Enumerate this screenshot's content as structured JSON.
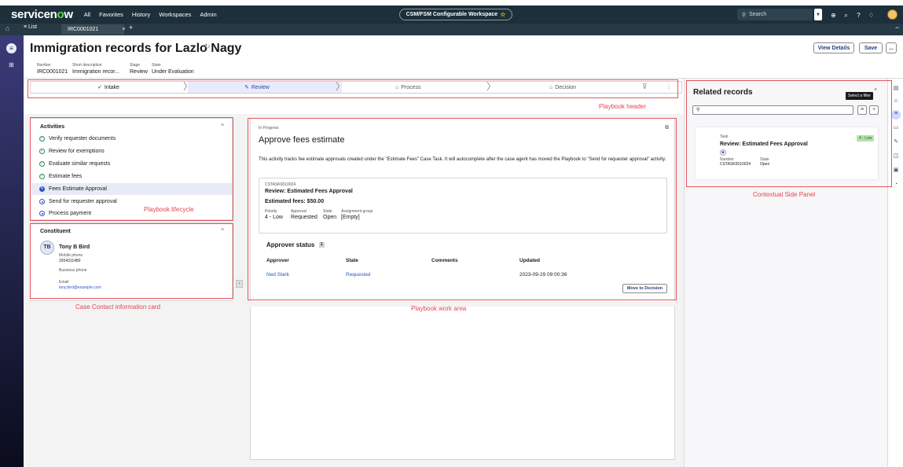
{
  "nav": {
    "logo_text": "servicenow",
    "links": [
      "All",
      "Favorites",
      "History",
      "Workspaces",
      "Admin"
    ],
    "workspace_title": "CSM/FSM Configurable Workspace",
    "search_placeholder": "Search"
  },
  "tabs": {
    "list_label": "List",
    "active_tab": "IRC0001021"
  },
  "record": {
    "title": "Immigration records for Lazlo Nagy",
    "fields": [
      {
        "label": "Number",
        "value": "IRC0001021"
      },
      {
        "label": "Short description",
        "value": "Immigration recor..."
      },
      {
        "label": "Stage",
        "value": "Review"
      },
      {
        "label": "State",
        "value": "Under Evaluation"
      }
    ],
    "buttons": {
      "view_details": "View Details",
      "save": "Save",
      "more": "..."
    }
  },
  "playbook": {
    "stages": [
      {
        "label": "Intake",
        "status": "done"
      },
      {
        "label": "Review",
        "status": "current"
      },
      {
        "label": "Process",
        "status": "locked"
      },
      {
        "label": "Decision",
        "status": "locked"
      }
    ]
  },
  "activities": {
    "title": "Activities",
    "items": [
      {
        "label": "Verify requester documents",
        "status": "done"
      },
      {
        "label": "Review for exemptions",
        "status": "done"
      },
      {
        "label": "Evaluate similar requests",
        "status": "done"
      },
      {
        "label": "Estimate fees",
        "status": "done"
      },
      {
        "label": "Fees Estimate Approval",
        "status": "current"
      },
      {
        "label": "Send for requester approval",
        "status": "pending"
      },
      {
        "label": "Process payment",
        "status": "pending"
      }
    ]
  },
  "constituent": {
    "title": "Constituent",
    "initials": "TB",
    "name": "Tony B Bird",
    "mobile_label": "Mobile phone",
    "mobile_value": "3204311480",
    "business_label": "Business phone",
    "email_label": "Email",
    "email_value": "tony.bird@example.com"
  },
  "work": {
    "status": "In Progress",
    "title": "Approve fees estimate",
    "description": "This activity tracks fee estimate approvals created under the \"Estimate Fees\" Case Task.  It will autocomplete after the case agent has moved the Playbook to \"Send for requester approval\" activity.",
    "task": {
      "number": "CSTASK0010024",
      "title": "Review: Estimated Fees Approval",
      "subtitle": "Estimated fees: $50.00",
      "fields": [
        {
          "label": "Priority",
          "value": "4 - Low"
        },
        {
          "label": "Approval",
          "value": "Requested"
        },
        {
          "label": "State",
          "value": "Open"
        },
        {
          "label": "Assignment group",
          "value": "[Empty]"
        }
      ]
    },
    "approver_status_title": "Approver status",
    "approver_count": "1",
    "columns": [
      "Approver",
      "State",
      "Comments",
      "Updated"
    ],
    "rows": [
      {
        "approver": "Ned Stark",
        "state": "Requested",
        "comments": "",
        "updated": "2023-09-29 09:00:36"
      }
    ],
    "move_button": "Move to Decision"
  },
  "related": {
    "title": "Related records",
    "tooltip": "Select a filter",
    "card": {
      "type": "Task",
      "badge": "4 - Low",
      "title": "Review: Estimated Fees Approval",
      "number_label": "Number",
      "number_value": "CSTASK0010024",
      "state_label": "State",
      "state_value": "Open"
    }
  },
  "annotations": {
    "playbook_header": "Playbook header",
    "playbook_lifecycle": "Playbook lifecycle",
    "contact_card": "Case Contact information card",
    "work_area": "Playbook work area",
    "side_panel": "Contextual Side Panel"
  },
  "colors": {
    "nav_bg": "#1c2f3a",
    "accent": "#2a55c4",
    "annotation": "#e7555f",
    "badge_low": "#b6e3a9"
  }
}
